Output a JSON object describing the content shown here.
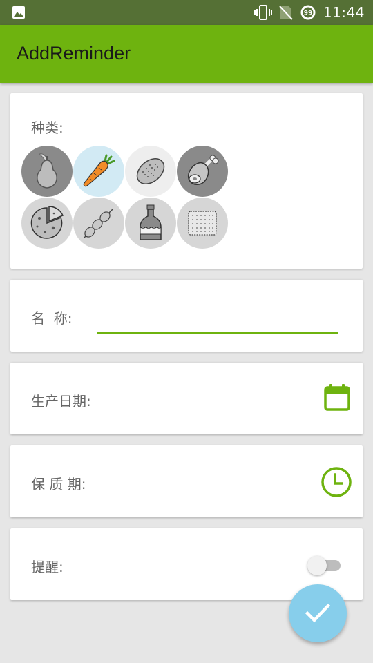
{
  "status_bar": {
    "time": "11:44",
    "icons": [
      "image-icon",
      "vibrate-icon",
      "no-sim-icon",
      "notification-99-icon"
    ],
    "notification_count": "99"
  },
  "app_bar": {
    "title": "AddReminder",
    "color": "#6eb30f"
  },
  "category_card": {
    "label": "种类:",
    "items": [
      {
        "icon": "pear-icon",
        "selected": false,
        "bg": "#8a8a8a"
      },
      {
        "icon": "carrot-icon",
        "selected": true,
        "bg": "#d2eaf4"
      },
      {
        "icon": "bread-icon",
        "selected": false,
        "bg": "#eeeeee"
      },
      {
        "icon": "ham-icon",
        "selected": false,
        "bg": "#8a8a8a"
      },
      {
        "icon": "pizza-icon",
        "selected": false,
        "bg": "#d6d6d6"
      },
      {
        "icon": "skewer-icon",
        "selected": false,
        "bg": "#d6d6d6"
      },
      {
        "icon": "bottle-icon",
        "selected": false,
        "bg": "#d6d6d6"
      },
      {
        "icon": "biscuit-icon",
        "selected": false,
        "bg": "#d6d6d6"
      }
    ]
  },
  "name_card": {
    "label": "名  称:",
    "value": "",
    "placeholder": ""
  },
  "production_date_card": {
    "label": "生产日期:",
    "icon": "calendar-icon"
  },
  "shelf_life_card": {
    "label": "保 质 期:",
    "icon": "clock-icon"
  },
  "reminder_card": {
    "label": "提醒:",
    "toggle_on": false
  },
  "fab": {
    "icon": "check-icon",
    "color": "#87ceeb"
  },
  "accent_color": "#6eb30f"
}
